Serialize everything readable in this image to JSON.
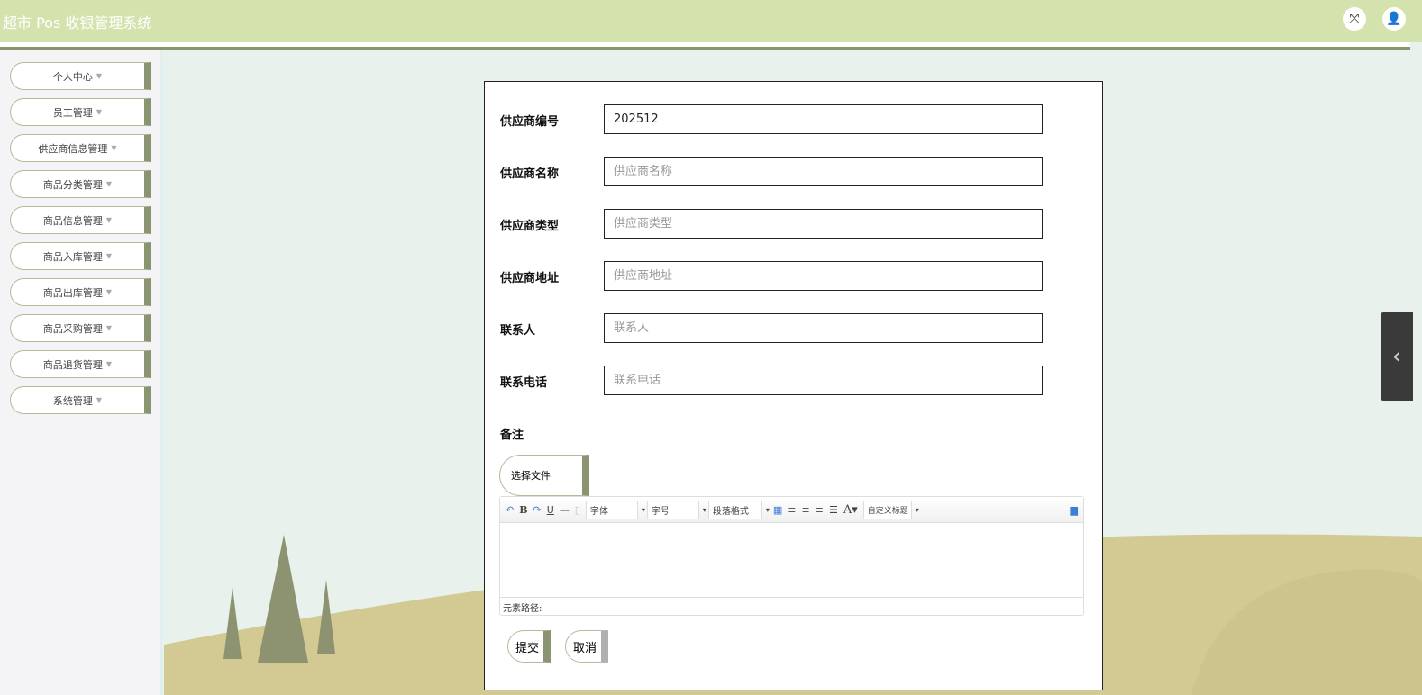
{
  "header": {
    "title": "超市 Pos 收银管理系统"
  },
  "sidebar": {
    "items": [
      {
        "label": "个人中心"
      },
      {
        "label": "员工管理"
      },
      {
        "label": "供应商信息管理"
      },
      {
        "label": "商品分类管理"
      },
      {
        "label": "商品信息管理"
      },
      {
        "label": "商品入库管理"
      },
      {
        "label": "商品出库管理"
      },
      {
        "label": "商品采购管理"
      },
      {
        "label": "商品退货管理"
      },
      {
        "label": "系统管理"
      }
    ]
  },
  "form": {
    "fields": [
      {
        "label": "供应商编号",
        "value": "202512",
        "placeholder": ""
      },
      {
        "label": "供应商名称",
        "value": "",
        "placeholder": "供应商名称"
      },
      {
        "label": "供应商类型",
        "value": "",
        "placeholder": "供应商类型"
      },
      {
        "label": "供应商地址",
        "value": "",
        "placeholder": "供应商地址"
      },
      {
        "label": "联系人",
        "value": "",
        "placeholder": "联系人"
      },
      {
        "label": "联系电话",
        "value": "",
        "placeholder": "联系电话"
      }
    ],
    "remark_label": "备注",
    "file_button": "选择文件",
    "editor": {
      "font": "字体",
      "size": "字号",
      "paragraph": "段落格式",
      "custom_title": "自定义标题",
      "path_label": "元素路径:"
    },
    "submit": "提交",
    "cancel": "取消"
  }
}
